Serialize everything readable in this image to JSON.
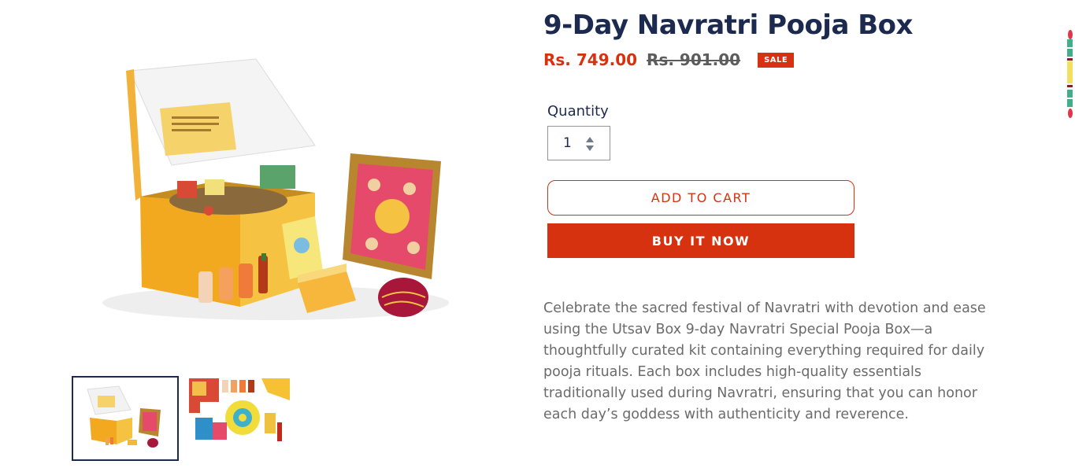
{
  "product": {
    "title": "9-Day Navratri Pooja Box",
    "price_sale": "Rs. 749.00",
    "price_regular": "Rs. 901.00",
    "badge": "SALE",
    "description": "Celebrate the sacred festival of Navratri with devotion and ease using the Utsav Box 9-day Navratri Special Pooja Box—a thoughtfully curated kit containing everything required for daily pooja rituals. Each box includes high-quality essentials traditionally used during Navratri, ensuring that you can honor each day’s goddess with authenticity and reverence."
  },
  "quantity": {
    "label": "Quantity",
    "value": "1"
  },
  "buttons": {
    "add_to_cart": "ADD TO CART",
    "buy_now": "BUY IT NOW"
  },
  "gallery": {
    "thumbnails": [
      "product-box-photo",
      "product-contents-flatlay"
    ],
    "selected_index": 0
  },
  "colors": {
    "accent": "#d6320f",
    "title": "#1c2a4f",
    "muted": "#6b6b6b"
  },
  "icons": {
    "qty_spinner": "stepper-arrows-icon"
  }
}
